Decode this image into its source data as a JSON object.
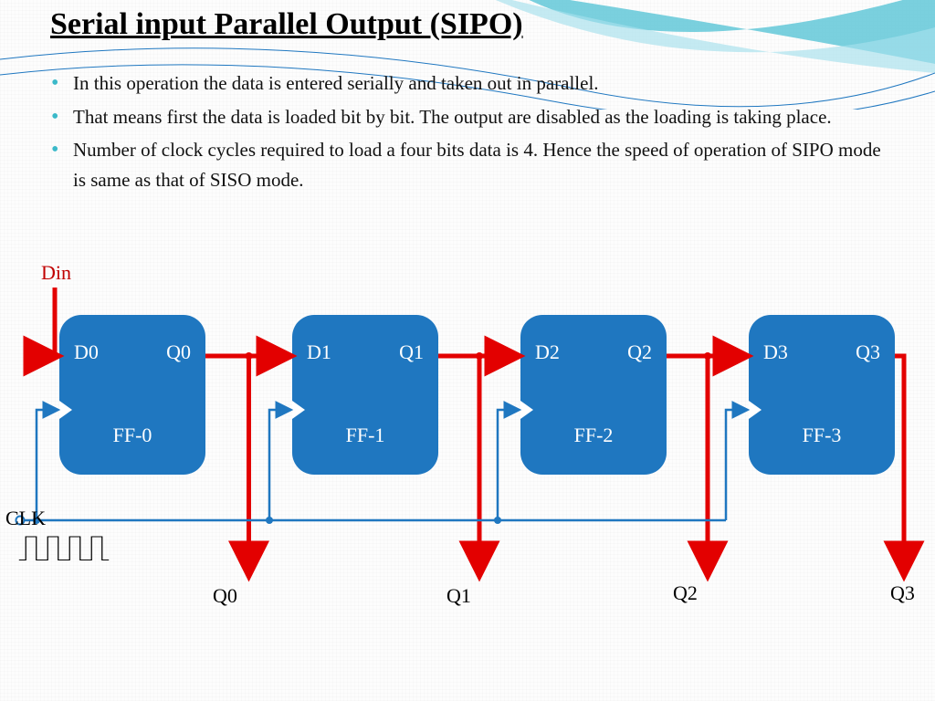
{
  "title": "Serial input Parallel Output (SIPO)",
  "bullets": [
    "In this operation the data is entered serially and taken out in parallel.",
    "That means first the data is loaded bit by bit. The output are disabled as the loading is taking place.",
    "Number of clock cycles required to load a four bits data is 4. Hence the speed of operation of SIPO mode is same as that of SISO mode."
  ],
  "signals": {
    "din": "Din",
    "clk": "CLK"
  },
  "flipflops": [
    {
      "d": "D0",
      "q": "Q0",
      "name": "FF-0"
    },
    {
      "d": "D1",
      "q": "Q1",
      "name": "FF-1"
    },
    {
      "d": "D2",
      "q": "Q2",
      "name": "FF-2"
    },
    {
      "d": "D3",
      "q": "Q3",
      "name": "FF-3"
    }
  ],
  "outputs": [
    "Q0",
    "Q1",
    "Q2",
    "Q3"
  ],
  "colors": {
    "box": "#1f77c0",
    "wire_data": "#e30000",
    "wire_clk": "#1f77c0",
    "bullet": "#3bb9c9"
  }
}
